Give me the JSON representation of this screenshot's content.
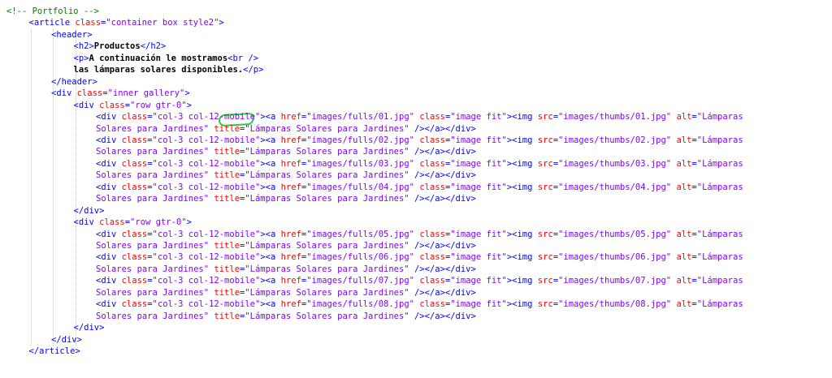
{
  "editor": {
    "lines": [
      {
        "indent": 0,
        "tokens": [
          [
            "c",
            "<!-- Portfolio -->"
          ]
        ]
      },
      {
        "indent": 1,
        "tokens": [
          [
            "t",
            "<article "
          ],
          [
            "a",
            "class"
          ],
          [
            "t",
            "="
          ],
          [
            "v",
            "\"container box style2\""
          ],
          [
            "t",
            ">"
          ]
        ]
      },
      {
        "indent": 2,
        "tokens": [
          [
            "t",
            "<header>"
          ]
        ]
      },
      {
        "indent": 3,
        "tokens": [
          [
            "t",
            "<h2>"
          ],
          [
            "x",
            "Productos"
          ],
          [
            "t",
            "</h2>"
          ]
        ]
      },
      {
        "indent": 3,
        "tokens": [
          [
            "t",
            "<p>"
          ],
          [
            "x",
            "A continuación le mostramos"
          ],
          [
            "t",
            "<br />"
          ]
        ]
      },
      {
        "indent": 3,
        "tokens": [
          [
            "x",
            "las lámparas solares disponibles."
          ],
          [
            "t",
            "</p>"
          ]
        ]
      },
      {
        "indent": 2,
        "tokens": [
          [
            "t",
            "</header>"
          ]
        ]
      },
      {
        "indent": 2,
        "tokens": [
          [
            "t",
            "<div "
          ],
          [
            "a",
            "class"
          ],
          [
            "t",
            "="
          ],
          [
            "v",
            "\"inner gallery\""
          ],
          [
            "t",
            ">"
          ]
        ]
      },
      {
        "indent": 3,
        "tokens": [
          [
            "t",
            "<div "
          ],
          [
            "a",
            "class"
          ],
          [
            "t",
            "="
          ],
          [
            "v",
            "\"row gtr-0\""
          ],
          [
            "t",
            ">"
          ]
        ]
      },
      {
        "indent": 4,
        "tokens": [
          [
            "t",
            "<div "
          ],
          [
            "a",
            "class"
          ],
          [
            "t",
            "="
          ],
          [
            "v",
            "\"col-3 col-12-mobile\""
          ],
          [
            "t",
            "><a "
          ],
          [
            "a",
            "href"
          ],
          [
            "t",
            "="
          ],
          [
            "v",
            "\"images/fulls/01.jpg\""
          ],
          [
            "t",
            " "
          ],
          [
            "a",
            "class"
          ],
          [
            "t",
            "="
          ],
          [
            "v",
            "\"image fit\""
          ],
          [
            "t",
            "><img "
          ],
          [
            "a",
            "src"
          ],
          [
            "t",
            "="
          ],
          [
            "v",
            "\"images/thumbs/01.jpg\""
          ],
          [
            "t",
            " "
          ],
          [
            "a",
            "alt"
          ],
          [
            "t",
            "="
          ],
          [
            "v",
            "\"Lámparas"
          ]
        ]
      },
      {
        "indent": 4,
        "tokens": [
          [
            "v",
            "Solares para Jardines\""
          ],
          [
            "t",
            " "
          ],
          [
            "a",
            "title"
          ],
          [
            "t",
            "="
          ],
          [
            "v",
            "\"Lámparas Solares para Jardines\""
          ],
          [
            "t",
            " /></a></div>"
          ]
        ]
      },
      {
        "indent": 4,
        "tokens": [
          [
            "t",
            "<div "
          ],
          [
            "a",
            "class"
          ],
          [
            "t",
            "="
          ],
          [
            "v",
            "\"col-3 col-12-mobile\""
          ],
          [
            "t",
            "><a "
          ],
          [
            "a",
            "href"
          ],
          [
            "t",
            "="
          ],
          [
            "v",
            "\"images/fulls/02.jpg\""
          ],
          [
            "t",
            " "
          ],
          [
            "a",
            "class"
          ],
          [
            "t",
            "="
          ],
          [
            "v",
            "\"image fit\""
          ],
          [
            "t",
            "><img "
          ],
          [
            "a",
            "src"
          ],
          [
            "t",
            "="
          ],
          [
            "v",
            "\"images/thumbs/02.jpg\""
          ],
          [
            "t",
            " "
          ],
          [
            "a",
            "alt"
          ],
          [
            "t",
            "="
          ],
          [
            "v",
            "\"Lámparas"
          ]
        ]
      },
      {
        "indent": 4,
        "tokens": [
          [
            "v",
            "Solares para Jardines\""
          ],
          [
            "t",
            " "
          ],
          [
            "a",
            "title"
          ],
          [
            "t",
            "="
          ],
          [
            "v",
            "\"Lámparas Solares para Jardines\""
          ],
          [
            "t",
            " /></a></div>"
          ]
        ]
      },
      {
        "indent": 4,
        "tokens": [
          [
            "t",
            "<div "
          ],
          [
            "a",
            "class"
          ],
          [
            "t",
            "="
          ],
          [
            "v",
            "\"col-3 col-12-mobile\""
          ],
          [
            "t",
            "><a "
          ],
          [
            "a",
            "href"
          ],
          [
            "t",
            "="
          ],
          [
            "v",
            "\"images/fulls/03.jpg\""
          ],
          [
            "t",
            " "
          ],
          [
            "a",
            "class"
          ],
          [
            "t",
            "="
          ],
          [
            "v",
            "\"image fit\""
          ],
          [
            "t",
            "><img "
          ],
          [
            "a",
            "src"
          ],
          [
            "t",
            "="
          ],
          [
            "v",
            "\"images/thumbs/03.jpg\""
          ],
          [
            "t",
            " "
          ],
          [
            "a",
            "alt"
          ],
          [
            "t",
            "="
          ],
          [
            "v",
            "\"Lámparas"
          ]
        ]
      },
      {
        "indent": 4,
        "tokens": [
          [
            "v",
            "Solares para Jardines\""
          ],
          [
            "t",
            " "
          ],
          [
            "a",
            "title"
          ],
          [
            "t",
            "="
          ],
          [
            "v",
            "\"Lámparas Solares para Jardines\""
          ],
          [
            "t",
            " /></a></div>"
          ]
        ]
      },
      {
        "indent": 4,
        "tokens": [
          [
            "t",
            "<div "
          ],
          [
            "a",
            "class"
          ],
          [
            "t",
            "="
          ],
          [
            "v",
            "\"col-3 col-12-mobile\""
          ],
          [
            "t",
            "><a "
          ],
          [
            "a",
            "href"
          ],
          [
            "t",
            "="
          ],
          [
            "v",
            "\"images/fulls/04.jpg\""
          ],
          [
            "t",
            " "
          ],
          [
            "a",
            "class"
          ],
          [
            "t",
            "="
          ],
          [
            "v",
            "\"image fit\""
          ],
          [
            "t",
            "><img "
          ],
          [
            "a",
            "src"
          ],
          [
            "t",
            "="
          ],
          [
            "v",
            "\"images/thumbs/04.jpg\""
          ],
          [
            "t",
            " "
          ],
          [
            "a",
            "alt"
          ],
          [
            "t",
            "="
          ],
          [
            "v",
            "\"Lámparas"
          ]
        ]
      },
      {
        "indent": 4,
        "tokens": [
          [
            "v",
            "Solares para Jardines\""
          ],
          [
            "t",
            " "
          ],
          [
            "a",
            "title"
          ],
          [
            "t",
            "="
          ],
          [
            "v",
            "\"Lámparas Solares para Jardines\""
          ],
          [
            "t",
            " /></a></div>"
          ]
        ]
      },
      {
        "indent": 3,
        "tokens": [
          [
            "t",
            "</div>"
          ]
        ]
      },
      {
        "indent": 3,
        "tokens": [
          [
            "t",
            "<div "
          ],
          [
            "a",
            "class"
          ],
          [
            "t",
            "="
          ],
          [
            "v",
            "\"row gtr-0\""
          ],
          [
            "t",
            ">"
          ]
        ]
      },
      {
        "indent": 4,
        "tokens": [
          [
            "t",
            "<div "
          ],
          [
            "a",
            "class"
          ],
          [
            "t",
            "="
          ],
          [
            "v",
            "\"col-3 col-12-mobile\""
          ],
          [
            "t",
            "><a "
          ],
          [
            "a",
            "href"
          ],
          [
            "t",
            "="
          ],
          [
            "v",
            "\"images/fulls/05.jpg\""
          ],
          [
            "t",
            " "
          ],
          [
            "a",
            "class"
          ],
          [
            "t",
            "="
          ],
          [
            "v",
            "\"image fit\""
          ],
          [
            "t",
            "><img "
          ],
          [
            "a",
            "src"
          ],
          [
            "t",
            "="
          ],
          [
            "v",
            "\"images/thumbs/05.jpg\""
          ],
          [
            "t",
            " "
          ],
          [
            "a",
            "alt"
          ],
          [
            "t",
            "="
          ],
          [
            "v",
            "\"Lámparas"
          ]
        ]
      },
      {
        "indent": 4,
        "tokens": [
          [
            "v",
            "Solares para Jardines\""
          ],
          [
            "t",
            " "
          ],
          [
            "a",
            "title"
          ],
          [
            "t",
            "="
          ],
          [
            "v",
            "\"Lámparas Solares para Jardines\""
          ],
          [
            "t",
            " /></a></div>"
          ]
        ]
      },
      {
        "indent": 4,
        "tokens": [
          [
            "t",
            "<div "
          ],
          [
            "a",
            "class"
          ],
          [
            "t",
            "="
          ],
          [
            "v",
            "\"col-3 col-12-mobile\""
          ],
          [
            "t",
            "><a "
          ],
          [
            "a",
            "href"
          ],
          [
            "t",
            "="
          ],
          [
            "v",
            "\"images/fulls/06.jpg\""
          ],
          [
            "t",
            " "
          ],
          [
            "a",
            "class"
          ],
          [
            "t",
            "="
          ],
          [
            "v",
            "\"image fit\""
          ],
          [
            "t",
            "><img "
          ],
          [
            "a",
            "src"
          ],
          [
            "t",
            "="
          ],
          [
            "v",
            "\"images/thumbs/06.jpg\""
          ],
          [
            "t",
            " "
          ],
          [
            "a",
            "alt"
          ],
          [
            "t",
            "="
          ],
          [
            "v",
            "\"Lámparas"
          ]
        ]
      },
      {
        "indent": 4,
        "tokens": [
          [
            "v",
            "Solares para Jardines\""
          ],
          [
            "t",
            " "
          ],
          [
            "a",
            "title"
          ],
          [
            "t",
            "="
          ],
          [
            "v",
            "\"Lámparas Solares para Jardines\""
          ],
          [
            "t",
            " /></a></div>"
          ]
        ]
      },
      {
        "indent": 4,
        "tokens": [
          [
            "t",
            "<div "
          ],
          [
            "a",
            "class"
          ],
          [
            "t",
            "="
          ],
          [
            "v",
            "\"col-3 col-12-mobile\""
          ],
          [
            "t",
            "><a "
          ],
          [
            "a",
            "href"
          ],
          [
            "t",
            "="
          ],
          [
            "v",
            "\"images/fulls/07.jpg\""
          ],
          [
            "t",
            " "
          ],
          [
            "a",
            "class"
          ],
          [
            "t",
            "="
          ],
          [
            "v",
            "\"image fit\""
          ],
          [
            "t",
            "><img "
          ],
          [
            "a",
            "src"
          ],
          [
            "t",
            "="
          ],
          [
            "v",
            "\"images/thumbs/07.jpg\""
          ],
          [
            "t",
            " "
          ],
          [
            "a",
            "alt"
          ],
          [
            "t",
            "="
          ],
          [
            "v",
            "\"Lámparas"
          ]
        ]
      },
      {
        "indent": 4,
        "tokens": [
          [
            "v",
            "Solares para Jardines\""
          ],
          [
            "t",
            " "
          ],
          [
            "a",
            "title"
          ],
          [
            "t",
            "="
          ],
          [
            "v",
            "\"Lámparas Solares para Jardines\""
          ],
          [
            "t",
            " /></a></div>"
          ]
        ]
      },
      {
        "indent": 4,
        "tokens": [
          [
            "t",
            "<div "
          ],
          [
            "a",
            "class"
          ],
          [
            "t",
            "="
          ],
          [
            "v",
            "\"col-3 col-12-mobile\""
          ],
          [
            "t",
            "><a "
          ],
          [
            "a",
            "href"
          ],
          [
            "t",
            "="
          ],
          [
            "v",
            "\"images/fulls/08.jpg\""
          ],
          [
            "t",
            " "
          ],
          [
            "a",
            "class"
          ],
          [
            "t",
            "="
          ],
          [
            "v",
            "\"image fit\""
          ],
          [
            "t",
            "><img "
          ],
          [
            "a",
            "src"
          ],
          [
            "t",
            "="
          ],
          [
            "v",
            "\"images/thumbs/08.jpg\""
          ],
          [
            "t",
            " "
          ],
          [
            "a",
            "alt"
          ],
          [
            "t",
            "="
          ],
          [
            "v",
            "\"Lámparas"
          ]
        ]
      },
      {
        "indent": 4,
        "tokens": [
          [
            "v",
            "Solares para Jardines\""
          ],
          [
            "t",
            " "
          ],
          [
            "a",
            "title"
          ],
          [
            "t",
            "="
          ],
          [
            "v",
            "\"Lámparas Solares para Jardines\""
          ],
          [
            "t",
            " /></a></div>"
          ]
        ]
      },
      {
        "indent": 3,
        "tokens": [
          [
            "t",
            "</div>"
          ]
        ]
      },
      {
        "indent": 2,
        "tokens": [
          [
            "t",
            "</div>"
          ]
        ]
      },
      {
        "indent": 1,
        "tokens": [
          [
            "t",
            "</article>"
          ]
        ]
      }
    ]
  },
  "colors": {
    "tag": "#0000ff",
    "attribute": "#ff0000",
    "value": "#8000ff",
    "text": "#000000",
    "comment": "#008000",
    "highlight": "#2ecc40"
  }
}
